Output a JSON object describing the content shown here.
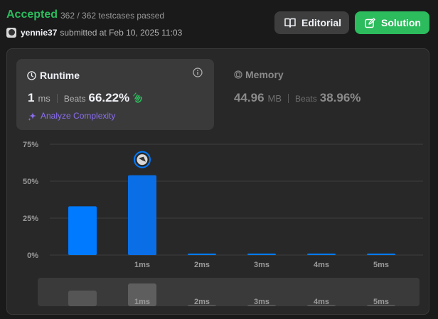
{
  "header": {
    "status": "Accepted",
    "testcases": "362 / 362 testcases passed",
    "username": "yennie37",
    "submitted_text": "submitted at Feb 10, 2025 11:03"
  },
  "buttons": {
    "editorial": "Editorial",
    "solution": "Solution"
  },
  "runtime": {
    "title": "Runtime",
    "value": "1",
    "unit": "ms",
    "beats_label": "Beats",
    "beats_value": "66.22%",
    "analyze_label": "Analyze Complexity"
  },
  "memory": {
    "title": "Memory",
    "value": "44.96",
    "unit": "MB",
    "beats_label": "Beats",
    "beats_value": "38.96%"
  },
  "colors": {
    "accepted": "#2cbb5d",
    "solution_button": "#2cbb5d",
    "bar": "#007aff",
    "bar_selected": "#0a6fe6",
    "analyze": "#8b6df0"
  },
  "icons": {
    "editorial": "book-icon",
    "solution": "edit-icon",
    "runtime": "clock-icon",
    "info": "info-icon",
    "memory": "chip-icon",
    "analyze": "sparkle-icon",
    "clap": "clap-icon",
    "marker": "avatar-marker-icon"
  },
  "chart_data": {
    "type": "bar",
    "categories": [
      "",
      "1ms",
      "2ms",
      "3ms",
      "4ms",
      "5ms"
    ],
    "values": [
      33,
      54,
      1,
      1,
      1,
      1
    ],
    "ylim": [
      0,
      75
    ],
    "yticks": [
      "75%",
      "50%",
      "25%",
      "0%"
    ],
    "ytick_values": [
      75,
      50,
      25,
      0
    ],
    "highlight_index": 1,
    "grid": true
  },
  "range_selector": {
    "labels": [
      "1ms",
      "2ms",
      "3ms",
      "4ms",
      "5ms"
    ],
    "values": [
      22,
      32,
      2,
      2,
      2,
      2
    ]
  }
}
